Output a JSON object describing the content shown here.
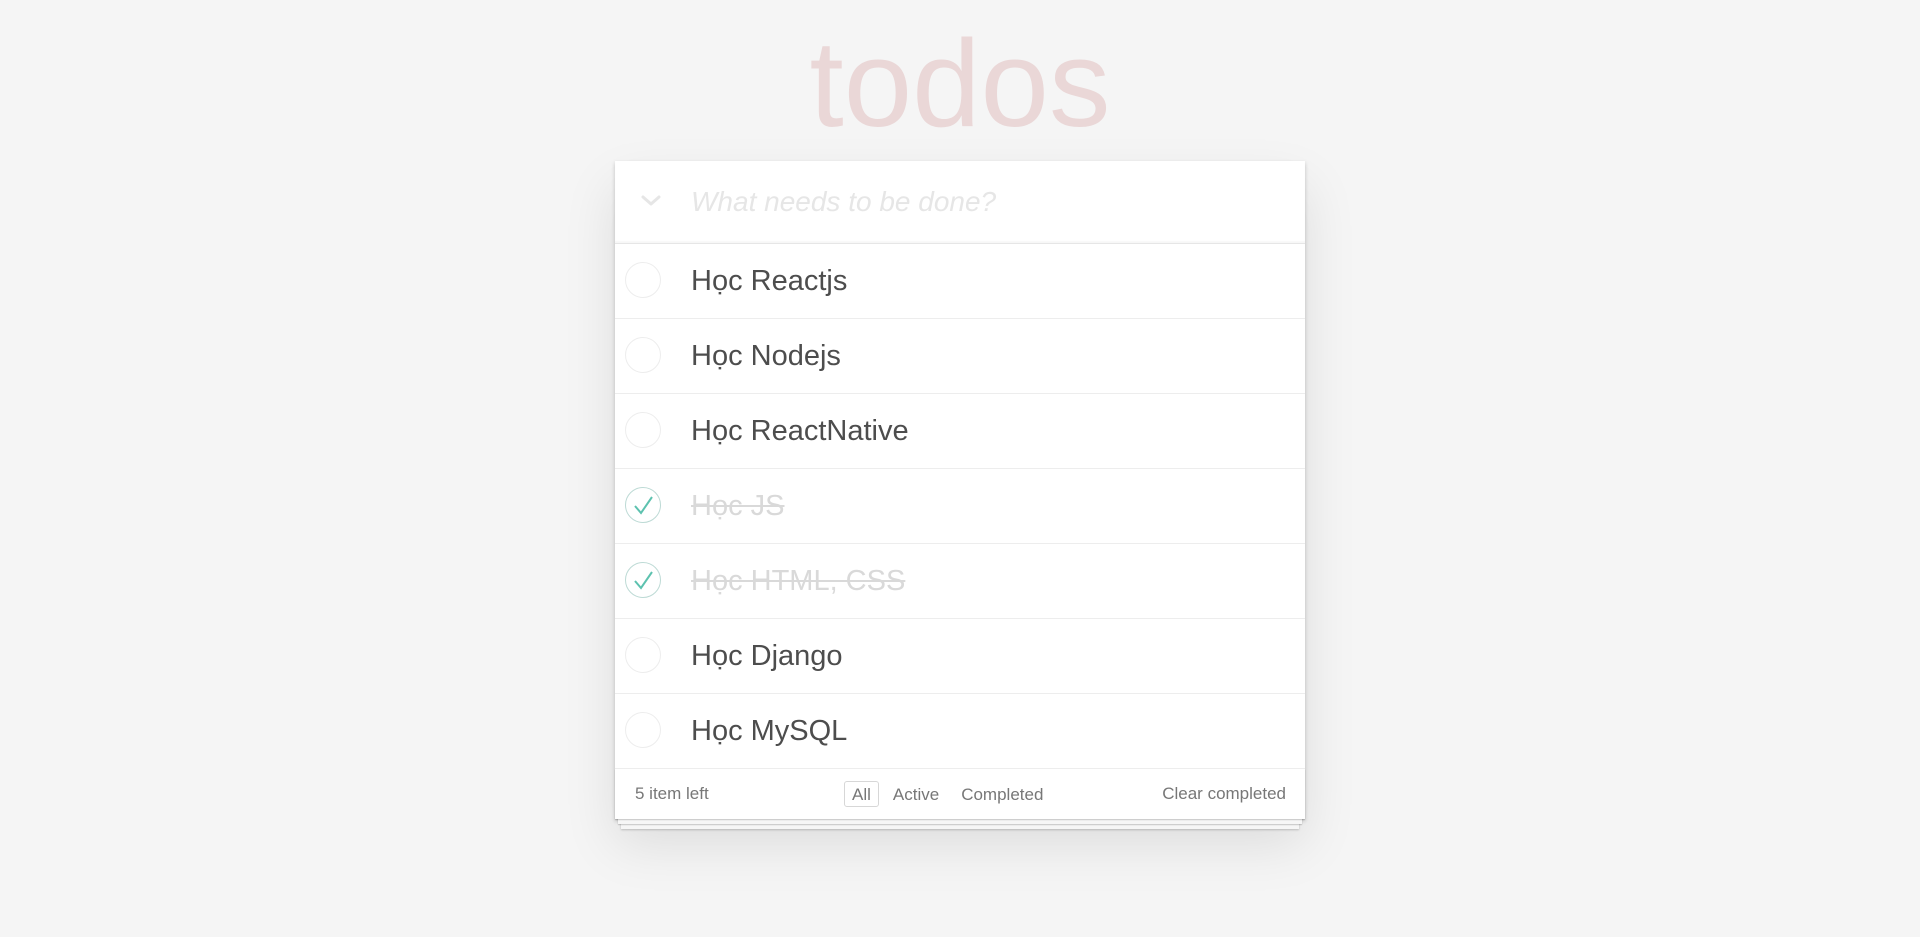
{
  "app": {
    "title": "todos"
  },
  "header": {
    "placeholder": "What needs to be done?",
    "toggle_all_icon": "chevron-down-icon"
  },
  "todos": [
    {
      "label": "Học Reactjs",
      "completed": false
    },
    {
      "label": "Học Nodejs",
      "completed": false
    },
    {
      "label": "Học ReactNative",
      "completed": false
    },
    {
      "label": "Học JS",
      "completed": true
    },
    {
      "label": "Học HTML, CSS",
      "completed": true
    },
    {
      "label": "Học Django",
      "completed": false
    },
    {
      "label": "Học MySQL",
      "completed": false
    }
  ],
  "footer": {
    "item_count": "5 item left",
    "filters": [
      "All",
      "Active",
      "Completed"
    ],
    "selected_filter": "All",
    "clear_completed": "Clear completed"
  },
  "colors": {
    "background": "#f5f5f5",
    "title": "#eaD7D7",
    "check": "#5dc2af",
    "completed_text": "#d9d9d9"
  }
}
